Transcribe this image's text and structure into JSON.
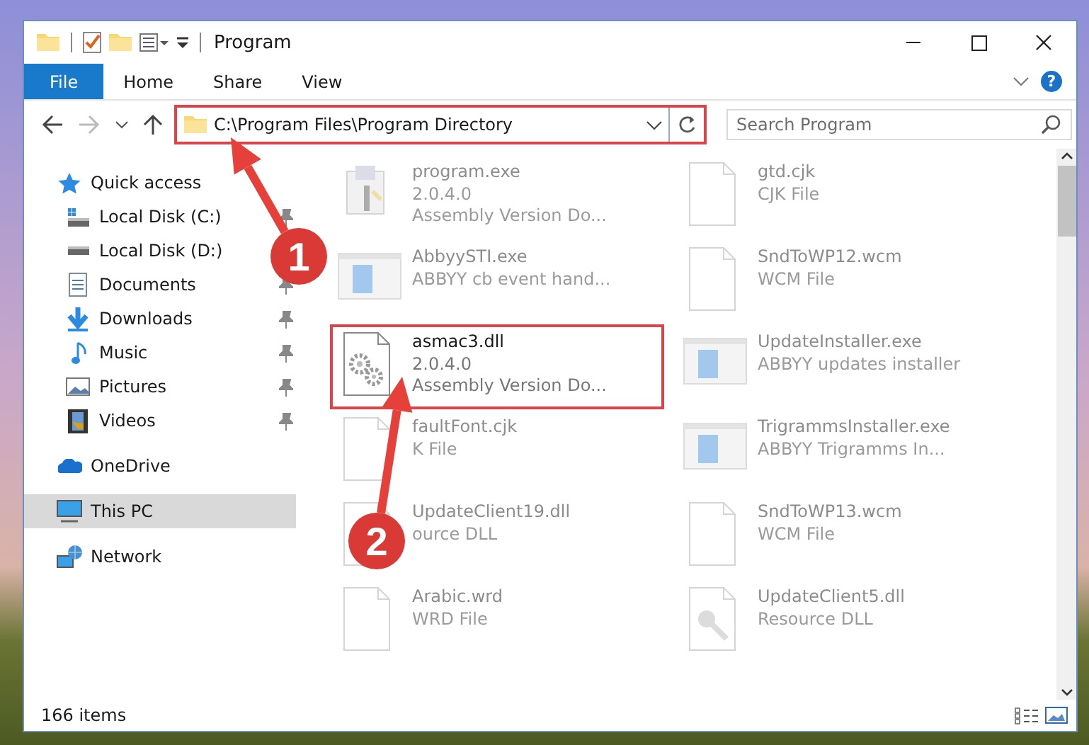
{
  "window": {
    "title": "Program",
    "help": "?"
  },
  "ribbon_tabs": [
    {
      "label": "File",
      "kind": "file",
      "selected": false
    },
    {
      "label": "Home",
      "kind": "tab",
      "selected": false
    },
    {
      "label": "Share",
      "kind": "tab",
      "selected": false
    },
    {
      "label": "View",
      "kind": "tab",
      "selected": false
    }
  ],
  "address_bar": {
    "path": "C:\\Program Files\\Program Directory",
    "marked": true
  },
  "search": {
    "placeholder": "Search Program"
  },
  "sidebar": {
    "items": [
      {
        "label": "Quick access",
        "kind": "star",
        "selected": false,
        "children": [
          {
            "label": "Local Disk (C:)",
            "kind": "system-drive",
            "pinned": true,
            "selected": false
          },
          {
            "label": "Local Disk (D:)",
            "kind": "drive",
            "selected": false
          },
          {
            "label": "Documents",
            "kind": "documents",
            "pinned": true,
            "selected": false
          },
          {
            "label": "Downloads",
            "kind": "downloads",
            "pinned": true,
            "selected": false
          },
          {
            "label": "Music",
            "kind": "music",
            "pinned": true,
            "selected": false
          },
          {
            "label": "Pictures",
            "kind": "pictures",
            "pinned": true,
            "selected": false
          },
          {
            "label": "Videos",
            "kind": "videos",
            "pinned": true,
            "selected": false
          }
        ]
      },
      {
        "label": "OneDrive",
        "kind": "cloud",
        "selected": false
      },
      {
        "label": "This PC",
        "kind": "computer",
        "selected": true
      },
      {
        "label": "Network",
        "kind": "network",
        "selected": false
      }
    ]
  },
  "files": [
    {
      "name": "program.exe",
      "details": [
        "2.0.4.0",
        "Assembly Version Do..."
      ],
      "kind": "installer",
      "dimmed": true,
      "marked": false
    },
    {
      "name": "gtd.cjk",
      "details": [
        "CJK File"
      ],
      "kind": "page",
      "dimmed": true,
      "marked": false
    },
    {
      "name": "AbbyySTI.exe",
      "details": [
        "ABBYY cb event hand..."
      ],
      "kind": "app",
      "dimmed": true,
      "marked": false
    },
    {
      "name": "SndToWP12.wcm",
      "details": [
        "WCM File"
      ],
      "kind": "page",
      "dimmed": true,
      "marked": false
    },
    {
      "name": "asmac3.dll",
      "details": [
        "2.0.4.0",
        "Assembly Version Do..."
      ],
      "kind": "library",
      "dimmed": false,
      "marked": true
    },
    {
      "name": "UpdateInstaller.exe",
      "details": [
        "ABBYY updates installer"
      ],
      "kind": "app",
      "dimmed": true,
      "marked": false
    },
    {
      "name": "faultFont.cjk",
      "details": [
        "K File"
      ],
      "kind": "page",
      "dimmed": true,
      "marked": false
    },
    {
      "name": "TrigrammsInstaller.exe",
      "details": [
        "ABBYY Trigramms In..."
      ],
      "kind": "app",
      "dimmed": true,
      "marked": false
    },
    {
      "name": "UpdateClient19.dll",
      "details": [
        "ource DLL"
      ],
      "kind": "resource",
      "dimmed": true,
      "marked": false
    },
    {
      "name": "SndToWP13.wcm",
      "details": [
        "WCM File"
      ],
      "kind": "page",
      "dimmed": true,
      "marked": false
    },
    {
      "name": "Arabic.wrd",
      "details": [
        "WRD File"
      ],
      "kind": "page",
      "dimmed": true,
      "marked": false
    },
    {
      "name": "UpdateClient5.dll",
      "details": [
        "Resource DLL"
      ],
      "kind": "resource",
      "dimmed": true,
      "marked": false
    }
  ],
  "status_bar": {
    "count": "166 items"
  },
  "callouts": [
    {
      "number": "1"
    },
    {
      "number": "2"
    }
  ]
}
